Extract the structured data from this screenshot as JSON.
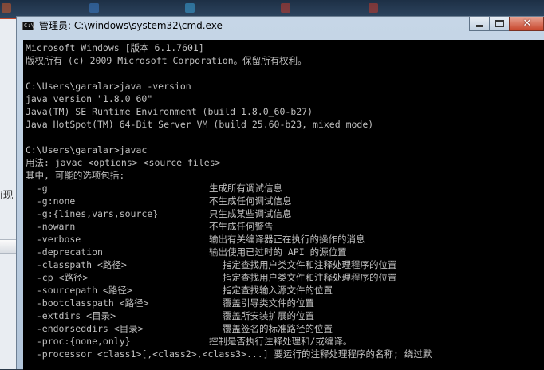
{
  "window": {
    "title": "管理员: C:\\windows\\system32\\cmd.exe",
    "icon_text": "C:\\",
    "close_glyph": "✕"
  },
  "background": {
    "left_text": "i现"
  },
  "console": {
    "lines": [
      {
        "text": "Microsoft Windows [版本 6.1.7601]"
      },
      {
        "text": "版权所有 (c) 2009 Microsoft Corporation。保留所有权利。"
      },
      {
        "text": ""
      },
      {
        "text": "C:\\Users\\garalar>java -version"
      },
      {
        "text": "java version \"1.8.0_60\""
      },
      {
        "text": "Java(TM) SE Runtime Environment (build 1.8.0_60-b27)"
      },
      {
        "text": "Java HotSpot(TM) 64-Bit Server VM (build 25.60-b23, mixed mode)"
      },
      {
        "text": ""
      },
      {
        "text": "C:\\Users\\garalar>javac"
      },
      {
        "text": "用法: javac <options> <source files>"
      },
      {
        "text": "其中, 可能的选项包括:"
      }
    ],
    "options": [
      {
        "opt": "  -g",
        "desc": "生成所有调试信息",
        "indent": "wide"
      },
      {
        "opt": "  -g:none",
        "desc": "不生成任何调试信息",
        "indent": "wide"
      },
      {
        "opt": "  -g:{lines,vars,source}",
        "desc": "只生成某些调试信息",
        "indent": "wide"
      },
      {
        "opt": "  -nowarn",
        "desc": "不生成任何警告",
        "indent": "wide"
      },
      {
        "opt": "  -verbose",
        "desc": "输出有关编译器正在执行的操作的消息",
        "indent": "wide"
      },
      {
        "opt": "  -deprecation",
        "desc": "输出使用已过时的 API 的源位置",
        "indent": "wide"
      },
      {
        "opt": "  -classpath <路径>",
        "desc": "指定查找用户类文件和注释处理程序的位置",
        "indent": "wider"
      },
      {
        "opt": "  -cp <路径>",
        "desc": "指定查找用户类文件和注释处理程序的位置",
        "indent": "wider"
      },
      {
        "opt": "  -sourcepath <路径>",
        "desc": "指定查找输入源文件的位置",
        "indent": "wider"
      },
      {
        "opt": "  -bootclasspath <路径>",
        "desc": "覆盖引导类文件的位置",
        "indent": "wider"
      },
      {
        "opt": "  -extdirs <目录>",
        "desc": "覆盖所安装扩展的位置",
        "indent": "wider"
      },
      {
        "opt": "  -endorseddirs <目录>",
        "desc": "覆盖签名的标准路径的位置",
        "indent": "wider"
      },
      {
        "opt": "  -proc:{none,only}",
        "desc": "控制是否执行注释处理和/或编译。",
        "indent": "wide"
      },
      {
        "opt": "  -processor <class1>[,<class2>,<class3>...] 要运行的注释处理程序的名称; 绕过默",
        "desc": "",
        "indent": "none"
      }
    ]
  }
}
